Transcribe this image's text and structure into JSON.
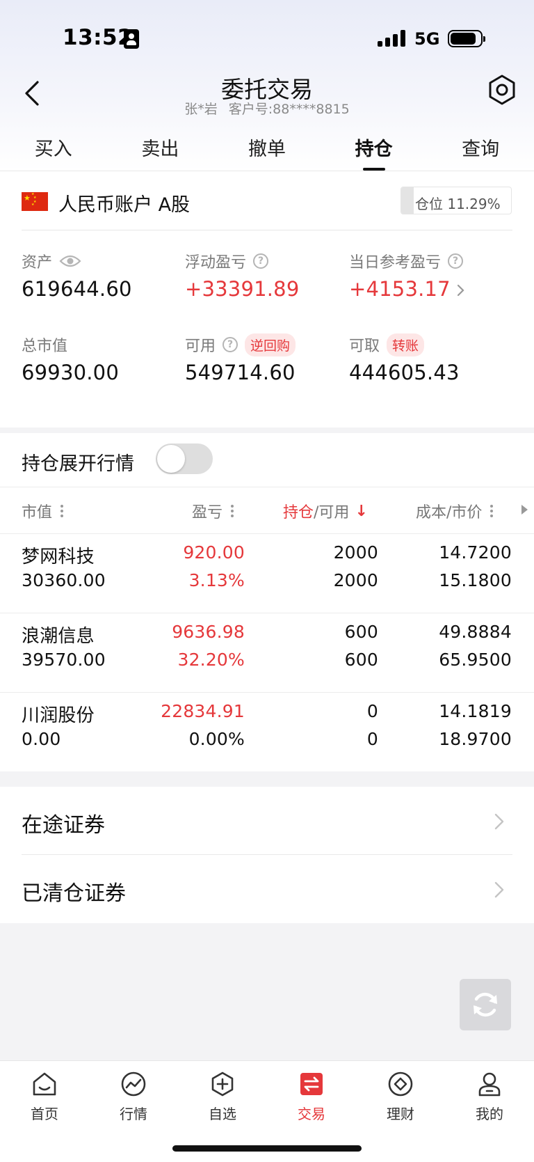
{
  "status": {
    "time": "13:52",
    "network": "5G",
    "battery_level": 0.85,
    "icons": [
      "id-badge-icon",
      "signal-icon",
      "battery-icon"
    ]
  },
  "header": {
    "title": "委托交易",
    "user_name": "张*岩",
    "customer_no": "客户号:88****8815",
    "icons": [
      "back-icon",
      "settings-icon"
    ]
  },
  "tabs": [
    {
      "label": "买入",
      "active": false
    },
    {
      "label": "卖出",
      "active": false
    },
    {
      "label": "撤单",
      "active": false
    },
    {
      "label": "持仓",
      "active": true
    },
    {
      "label": "查询",
      "active": false
    }
  ],
  "account": {
    "name": "人民币账户 A股",
    "position_label": "仓位 11.29%",
    "position_ratio": 0.1129,
    "flag_icon": "china-flag-icon",
    "metrics": {
      "assets": {
        "label": "资产",
        "value": "619644.60"
      },
      "floating_pl": {
        "label": "浮动盈亏",
        "value": "+33391.89"
      },
      "today_pl": {
        "label": "当日参考盈亏",
        "value": "+4153.17"
      },
      "market_value": {
        "label": "总市值",
        "value": "69930.00"
      },
      "available": {
        "label": "可用",
        "value": "549714.60",
        "tag": "逆回购"
      },
      "withdrawable": {
        "label": "可取",
        "value": "444605.43",
        "tag": "转账"
      }
    }
  },
  "holdings": {
    "toggle_label": "持仓展开行情",
    "toggle_on": false,
    "columns": {
      "market_value": "市值",
      "pl": "盈亏",
      "position_part1": "持仓",
      "position_part2": "/可用",
      "cost_price": "成本/市价"
    },
    "rows": [
      {
        "name": "梦网科技",
        "market_value": "30360.00",
        "pl": "920.00",
        "pl_pct": "3.13%",
        "qty": "2000",
        "available": "2000",
        "cost": "14.7200",
        "price": "15.1800"
      },
      {
        "name": "浪潮信息",
        "market_value": "39570.00",
        "pl": "9636.98",
        "pl_pct": "32.20%",
        "qty": "600",
        "available": "600",
        "cost": "49.8884",
        "price": "65.9500"
      },
      {
        "name": "川润股份",
        "market_value": "0.00",
        "pl": "22834.91",
        "pl_pct": "0.00%",
        "qty": "0",
        "available": "0",
        "cost": "14.1819",
        "price": "18.9700"
      }
    ]
  },
  "list": [
    {
      "label": "在途证券"
    },
    {
      "label": "已清仓证券"
    }
  ],
  "bottom_nav": [
    {
      "label": "首页",
      "icon": "home-icon",
      "active": false
    },
    {
      "label": "行情",
      "icon": "market-icon",
      "active": false
    },
    {
      "label": "自选",
      "icon": "watchlist-icon",
      "active": false
    },
    {
      "label": "交易",
      "icon": "trade-icon",
      "active": true
    },
    {
      "label": "理财",
      "icon": "wealth-icon",
      "active": false
    },
    {
      "label": "我的",
      "icon": "profile-icon",
      "active": false
    }
  ],
  "colors": {
    "accent_red": "#e5383b",
    "text_primary": "#111111",
    "text_secondary": "#7a7a7a",
    "background": "#f3f3f5"
  }
}
